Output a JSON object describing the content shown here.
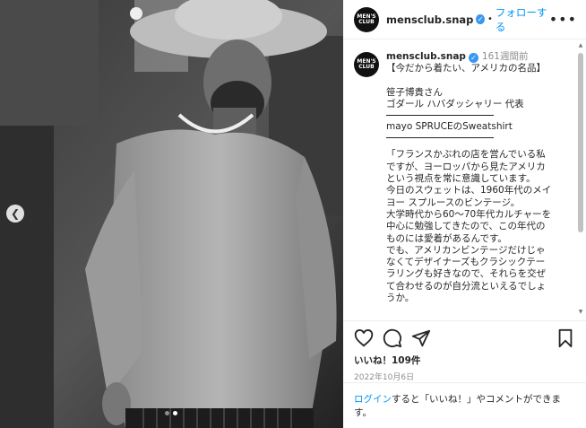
{
  "post": {
    "username": "mensclub.snap",
    "avatar_text": "MEN'S CLUB",
    "follow_label": "フォローする",
    "more_icon": "more-horizontal-icon",
    "verified_icon": "verified-badge-icon"
  },
  "caption": {
    "username": "mensclub.snap",
    "time": "161週間前",
    "title": "【今だから着たい、アメリカの名品】",
    "name": "笹子博貴さん",
    "role": "ゴダール ハバダッシャリー 代表",
    "item": "mayo SPRUCEのSweatshirt",
    "body_lines": [
      "「フランスかぶれの店を営んでいる私",
      "ですが、ヨーロッパから見たアメリカ",
      "という視点を常に意識しています。",
      "今日のスウェットは、1960年代のメイ",
      "ヨー スプルースのビンテージ。",
      "大学時代から60〜70年代カルチャーを",
      "中心に勉強してきたので、この年代の",
      "ものには愛着があるんです。",
      "でも、アメリカンビンテージだけじゃ",
      "なくてデザイナーズもクラシックテー",
      "ラリングも好きなので、それらを交ぜ",
      "て合わせるのが自分流といえるでしょ",
      "うか。"
    ]
  },
  "actions": {
    "likes": "いいね！109件",
    "date": "2022年10月6日"
  },
  "login": {
    "link": "ログイン",
    "text": "すると「いいね！」やコメントができます。"
  }
}
